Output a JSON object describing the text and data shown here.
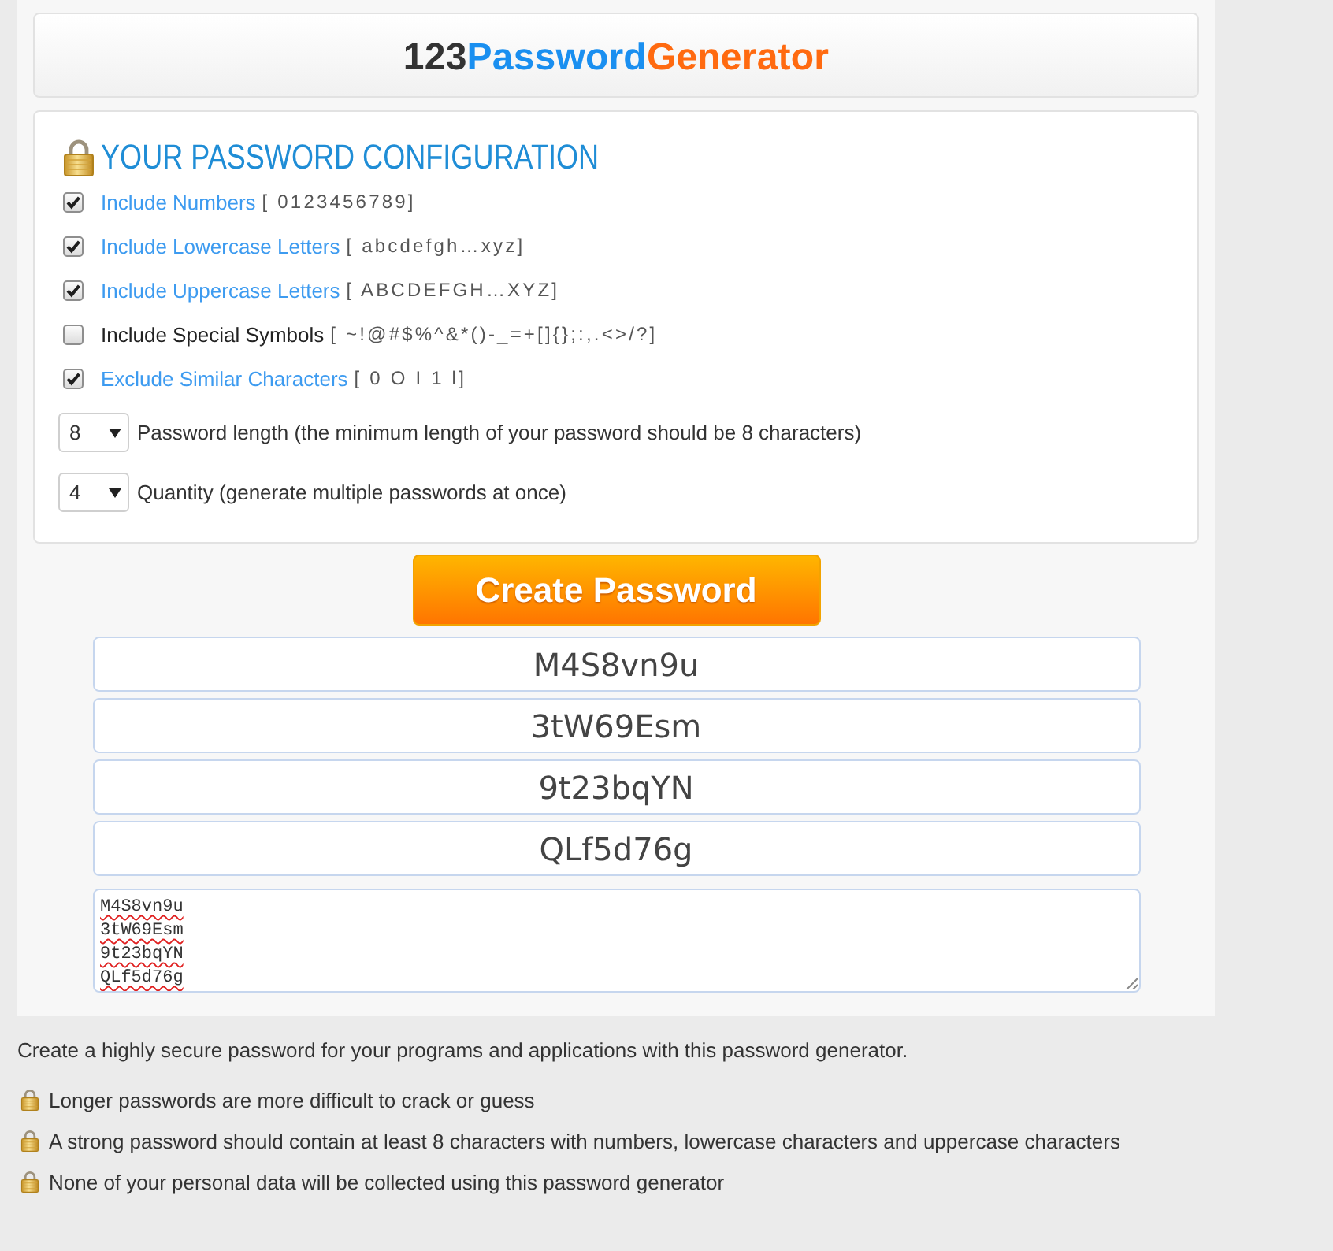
{
  "header": {
    "logo": [
      {
        "text": "123",
        "color": "#333333"
      },
      {
        "text": "Password",
        "color": "#1a8ff0"
      },
      {
        "text": "Generator",
        "color": "#ff6a10"
      }
    ]
  },
  "config": {
    "title": "YOUR PASSWORD CONFIGURATION",
    "options": [
      {
        "label": "Include Numbers",
        "chars": "[ 0123456789]",
        "checked": true
      },
      {
        "label": "Include Lowercase Letters",
        "chars": "[ abcdefgh…xyz]",
        "checked": true
      },
      {
        "label": "Include Uppercase Letters",
        "chars": "[ ABCDEFGH…XYZ]",
        "checked": true
      },
      {
        "label": "Include Special Symbols",
        "chars": "[ ~!@#$%^&*()-_=+[]{};:,.<>/?]",
        "checked": false
      },
      {
        "label": "Exclude Similar Characters",
        "chars": "[ 0 O I 1 l]",
        "checked": true
      }
    ],
    "selects": [
      {
        "value": "8",
        "label": "Password length (the minimum length of your password should be 8 characters)"
      },
      {
        "value": "4",
        "label": "Quantity (generate multiple passwords at once)"
      }
    ]
  },
  "create_button": {
    "label": "Create Password"
  },
  "passwords": [
    "M4S8vn9u",
    "3tW69Esm",
    "9t23bqYN",
    "QLf5d76g"
  ],
  "textarea": {
    "value": "M4S8vn9u\n3tW69Esm\n9t23bqYN\nQLf5d76g"
  },
  "info": {
    "intro": "Create a highly secure password for your programs and applications with this password generator.",
    "tips": [
      "Longer passwords are more difficult to crack or guess",
      "A strong password should contain at least 8 characters with numbers, lowercase characters and uppercase characters",
      "None of your personal data will be collected using this password generator"
    ]
  }
}
